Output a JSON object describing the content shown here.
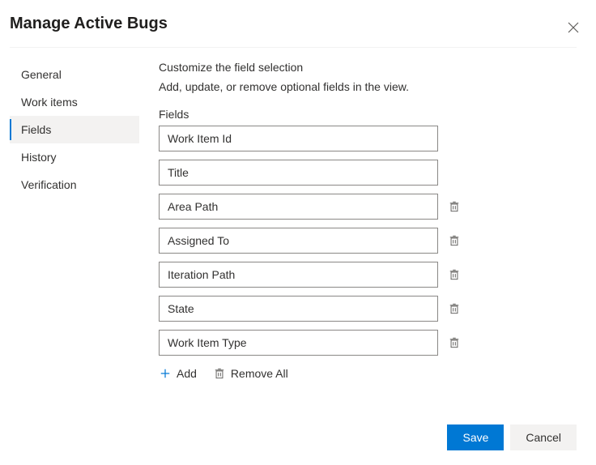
{
  "header": {
    "title": "Manage Active Bugs"
  },
  "sidebar": {
    "items": [
      {
        "label": "General",
        "selected": false
      },
      {
        "label": "Work items",
        "selected": false
      },
      {
        "label": "Fields",
        "selected": true
      },
      {
        "label": "History",
        "selected": false
      },
      {
        "label": "Verification",
        "selected": false
      }
    ]
  },
  "main": {
    "heading": "Customize the field selection",
    "description": "Add, update, or remove optional fields in the view.",
    "fieldsLabel": "Fields",
    "fields": [
      {
        "name": "Work Item Id",
        "removable": false
      },
      {
        "name": "Title",
        "removable": false
      },
      {
        "name": "Area Path",
        "removable": true
      },
      {
        "name": "Assigned To",
        "removable": true
      },
      {
        "name": "Iteration Path",
        "removable": true
      },
      {
        "name": "State",
        "removable": true
      },
      {
        "name": "Work Item Type",
        "removable": true
      }
    ],
    "addLabel": "Add",
    "removeAllLabel": "Remove All"
  },
  "footer": {
    "save": "Save",
    "cancel": "Cancel"
  }
}
